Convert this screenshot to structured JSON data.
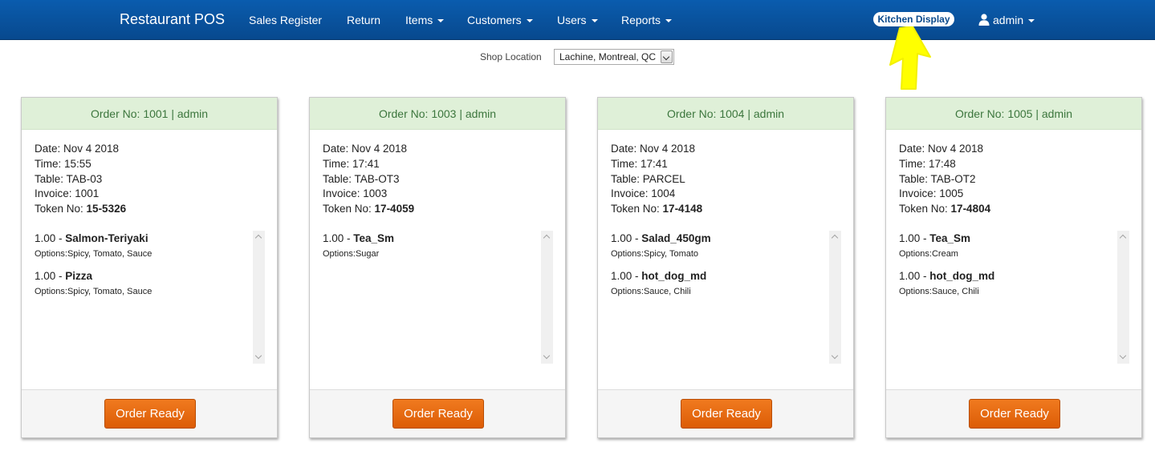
{
  "navbar": {
    "brand": "Restaurant POS",
    "items": [
      {
        "label": "Sales Register",
        "dropdown": false
      },
      {
        "label": "Return",
        "dropdown": false
      },
      {
        "label": "Items",
        "dropdown": true
      },
      {
        "label": "Customers",
        "dropdown": true
      },
      {
        "label": "Users",
        "dropdown": true
      },
      {
        "label": "Reports",
        "dropdown": true
      }
    ],
    "kitchen_display": "Kitchen Display",
    "user": "admin",
    "colors": {
      "bar": "#0a5cae",
      "annotation": "#ffff00"
    }
  },
  "shop": {
    "label": "Shop Location",
    "selected": "Lachine, Montreal, QC"
  },
  "orders": [
    {
      "header": "Order No: 1001  |  admin",
      "date": "Date: Nov 4 2018",
      "time": "Time: 15:55",
      "table": "Table: TAB-03",
      "invoice": "Invoice: 1001",
      "token_label": "Token No: ",
      "token": "15-5326",
      "items": [
        {
          "qty": "1.00 - ",
          "name": "Salmon-Teriyaki",
          "options": "Options:Spicy, Tomato, Sauce"
        },
        {
          "qty": "1.00 - ",
          "name": "Pizza",
          "options": "Options:Spicy, Tomato, Sauce"
        }
      ],
      "button": "Order Ready"
    },
    {
      "header": "Order No: 1003  |  admin",
      "date": "Date: Nov 4 2018",
      "time": "Time: 17:41",
      "table": "Table: TAB-OT3",
      "invoice": "Invoice: 1003",
      "token_label": "Token No: ",
      "token": "17-4059",
      "items": [
        {
          "qty": "1.00 - ",
          "name": "Tea_Sm",
          "options": "Options:Sugar"
        }
      ],
      "button": "Order Ready"
    },
    {
      "header": "Order No: 1004  |  admin",
      "date": "Date: Nov 4 2018",
      "time": "Time: 17:41",
      "table": "Table: PARCEL",
      "invoice": "Invoice: 1004",
      "token_label": "Token No: ",
      "token": "17-4148",
      "items": [
        {
          "qty": "1.00 - ",
          "name": "Salad_450gm",
          "options": "Options:Spicy, Tomato"
        },
        {
          "qty": "1.00 - ",
          "name": "hot_dog_md",
          "options": "Options:Sauce, Chili"
        }
      ],
      "button": "Order Ready"
    },
    {
      "header": "Order No: 1005  |  admin",
      "date": "Date: Nov 4 2018",
      "time": "Time: 17:48",
      "table": "Table: TAB-OT2",
      "invoice": "Invoice: 1005",
      "token_label": "Token No: ",
      "token": "17-4804",
      "items": [
        {
          "qty": "1.00 - ",
          "name": "Tea_Sm",
          "options": "Options:Cream"
        },
        {
          "qty": "1.00 - ",
          "name": "hot_dog_md",
          "options": "Options:Sauce, Chili"
        }
      ],
      "button": "Order Ready"
    }
  ]
}
